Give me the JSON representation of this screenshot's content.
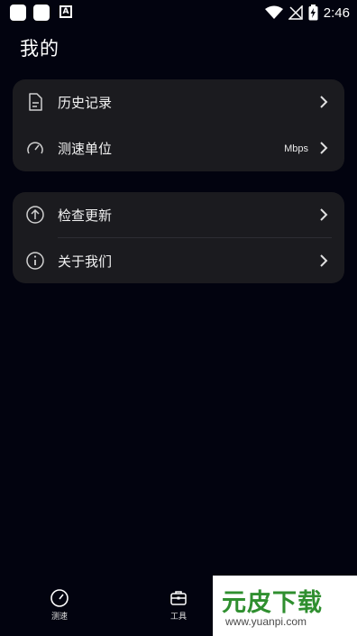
{
  "status_bar": {
    "time": "2:46"
  },
  "page_title": "我的",
  "card1": {
    "items": [
      {
        "label": "历史记录",
        "value": ""
      },
      {
        "label": "测速单位",
        "value": "Mbps"
      }
    ]
  },
  "card2": {
    "items": [
      {
        "label": "检查更新"
      },
      {
        "label": "关于我们"
      }
    ]
  },
  "tabbar": {
    "tabs": [
      {
        "label": "测速",
        "icon": "speedometer-icon"
      },
      {
        "label": "工具",
        "icon": "toolbox-icon"
      }
    ]
  },
  "watermark": {
    "title": "元皮下载",
    "url": "www.yuanpi.com"
  },
  "colors": {
    "background": "#02030f",
    "card": "#1b1b1f",
    "watermark_green": "#2f8f2f"
  }
}
